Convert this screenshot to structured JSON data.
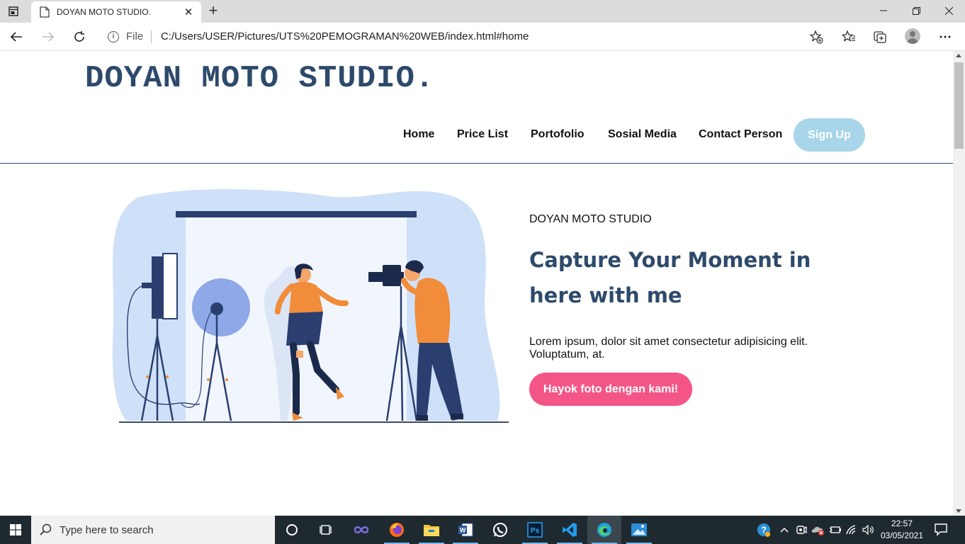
{
  "browser": {
    "tab_title": "DOYAN MOTO STUDIO.",
    "file_label": "File",
    "url": "C:/Users/USER/Pictures/UTS%20PEMOGRAMAN%20WEB/index.html#home"
  },
  "site": {
    "brand": "DOYAN MOTO STUDIO.",
    "nav": [
      "Home",
      "Price List",
      "Portofolio",
      "Sosial Media",
      "Contact Person"
    ],
    "signup": "Sign Up"
  },
  "hero": {
    "subtitle": "DOYAN MOTO STUDIO",
    "title": "Capture Your Moment in here with me",
    "text": "Lorem ipsum, dolor sit amet consectetur adipisicing elit. Voluptatum, at.",
    "cta": "Hayok foto dengan kami!"
  },
  "taskbar": {
    "search_placeholder": "Type here to search",
    "time": "22:57",
    "date": "03/05/2021",
    "apps": [
      "task-view-icon",
      "infinity-app-icon",
      "firefox-icon",
      "file-explorer-icon",
      "word-icon",
      "whatsapp-icon",
      "photoshop-icon",
      "vscode-icon",
      "edge-icon",
      "photos-icon"
    ]
  },
  "colors": {
    "brand": "#2e4a6b",
    "signup_bg": "#a8d5ea",
    "cta_bg": "#f35686",
    "illustration_bg": "#cfe1f8"
  }
}
